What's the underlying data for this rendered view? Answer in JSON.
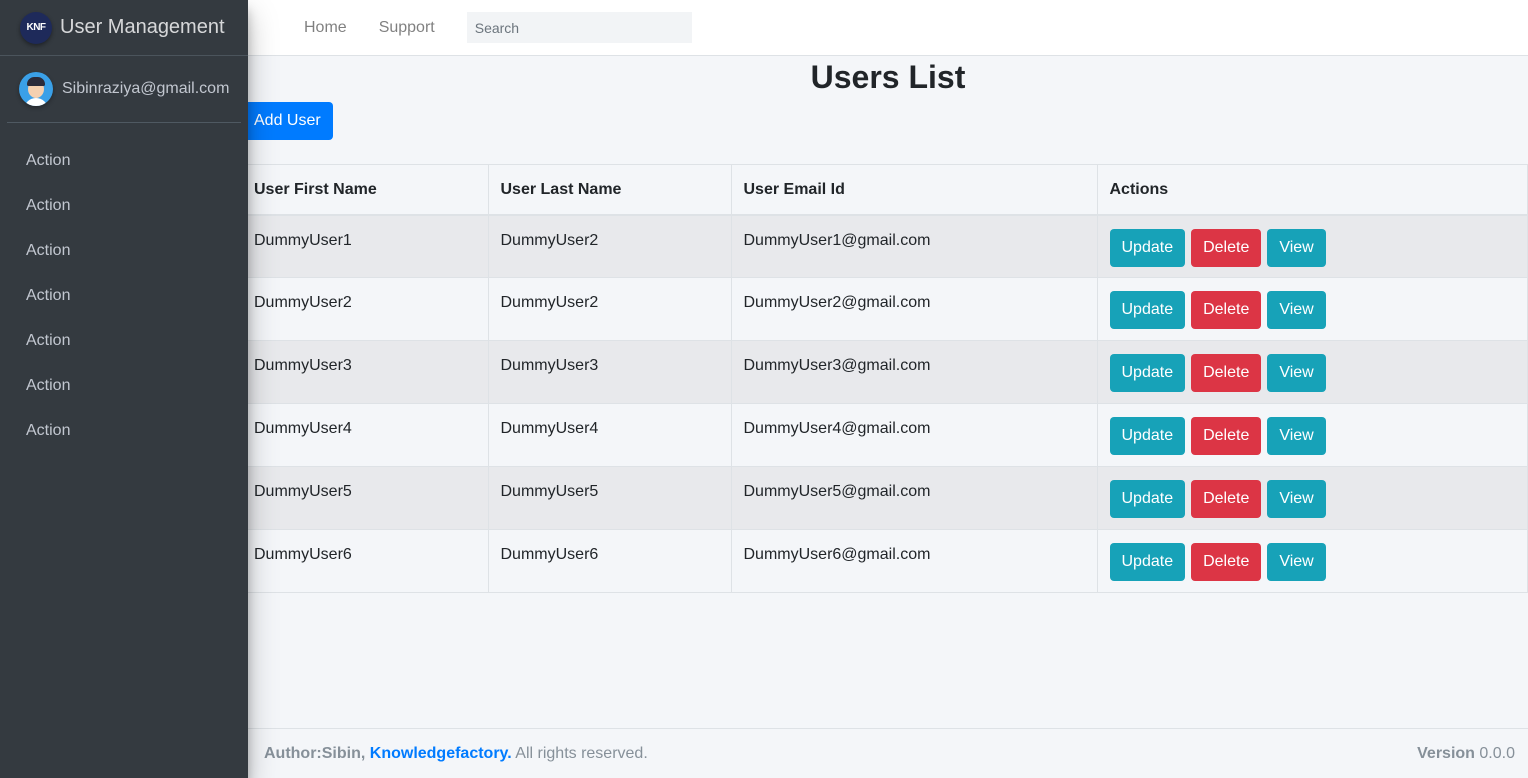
{
  "brand": {
    "logo_text": "KNF",
    "title": "User Management"
  },
  "user": {
    "email": "Sibinraziya@gmail.com"
  },
  "sidebar": {
    "items": [
      {
        "label": "Action"
      },
      {
        "label": "Action"
      },
      {
        "label": "Action"
      },
      {
        "label": "Action"
      },
      {
        "label": "Action"
      },
      {
        "label": "Action"
      },
      {
        "label": "Action"
      }
    ]
  },
  "navbar": {
    "home": "Home",
    "support": "Support",
    "search_placeholder": "Search"
  },
  "main": {
    "title": "Users List",
    "add_button": "Add User",
    "table": {
      "headers": [
        "User First Name",
        "User Last Name",
        "User Email Id",
        "Actions"
      ],
      "rows": [
        {
          "first": "DummyUser1",
          "last": "DummyUser2",
          "email": "DummyUser1@gmail.com"
        },
        {
          "first": "DummyUser2",
          "last": "DummyUser2",
          "email": "DummyUser2@gmail.com"
        },
        {
          "first": "DummyUser3",
          "last": "DummyUser3",
          "email": "DummyUser3@gmail.com"
        },
        {
          "first": "DummyUser4",
          "last": "DummyUser4",
          "email": "DummyUser4@gmail.com"
        },
        {
          "first": "DummyUser5",
          "last": "DummyUser5",
          "email": "DummyUser5@gmail.com"
        },
        {
          "first": "DummyUser6",
          "last": "DummyUser6",
          "email": "DummyUser6@gmail.com"
        }
      ],
      "update_label": "Update",
      "delete_label": "Delete",
      "view_label": "View"
    }
  },
  "footer": {
    "author": "Author:Sibin,",
    "company": "Knowledgefactory.",
    "rights": "All rights reserved.",
    "version_label": "Version",
    "version": "0.0.0"
  },
  "colors": {
    "sidebar_bg": "#343a40",
    "primary": "#007bff",
    "info": "#17a2b8",
    "danger": "#dc3545"
  }
}
